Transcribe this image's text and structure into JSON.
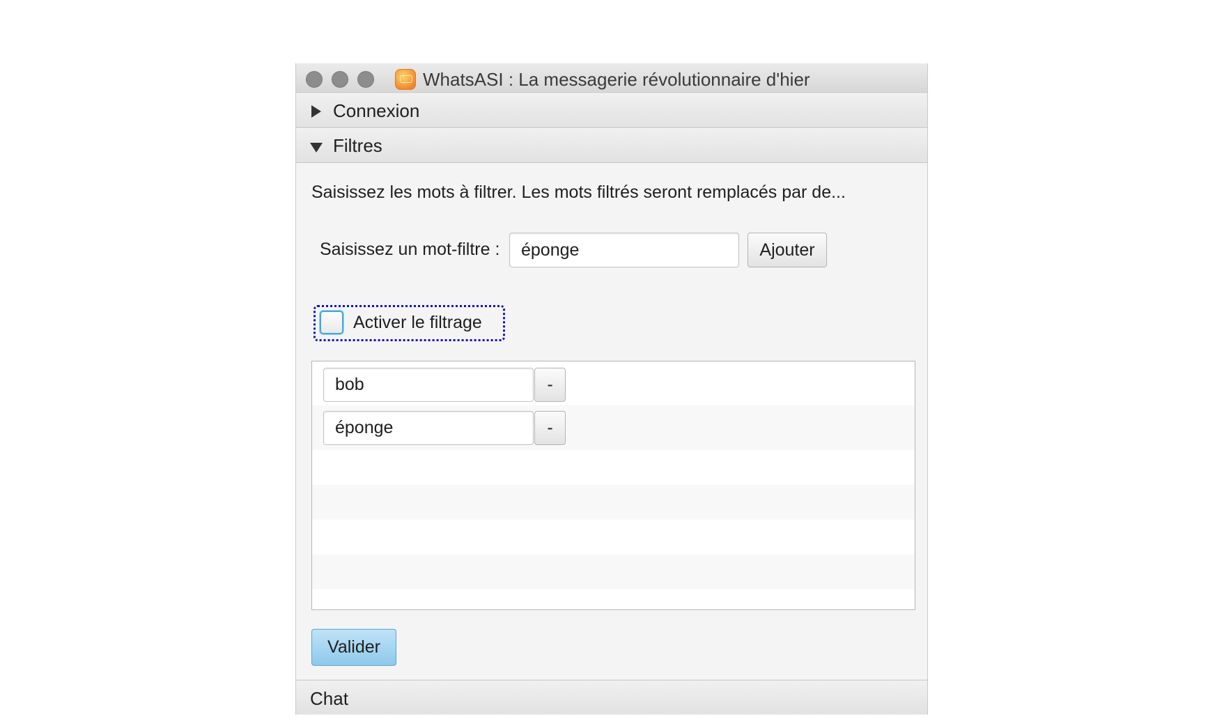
{
  "window": {
    "title": "WhatsASI : La messagerie révolutionnaire d'hier",
    "icon": "app-icon"
  },
  "accordion": {
    "connexion_label": "Connexion",
    "filtres_label": "Filtres",
    "chat_label": "Chat"
  },
  "filtres": {
    "description": "Saisissez les mots à filtrer. Les mots filtrés seront remplacés par de...",
    "input_label": "Saisissez un mot-filtre :",
    "input_value": "éponge",
    "add_button": "Ajouter",
    "checkbox_label": "Activer le filtrage",
    "checkbox_checked": false,
    "words": [
      {
        "value": "bob",
        "remove_label": "-"
      },
      {
        "value": "éponge",
        "remove_label": "-"
      }
    ],
    "validate_button": "Valider"
  },
  "colors": {
    "accent_blue": "#8ec9ea",
    "focus_ring": "#1010c8"
  }
}
